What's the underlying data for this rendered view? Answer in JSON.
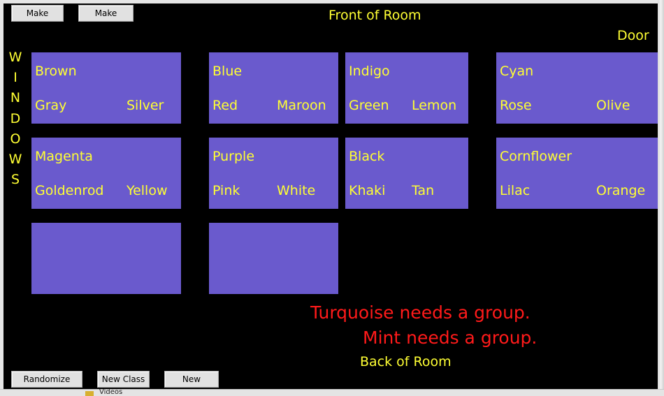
{
  "toolbar": {
    "make_bigger": "Make bigger",
    "make_smaller": "Make smaller"
  },
  "room": {
    "front": "Front of Room",
    "door": "Door",
    "windows_letters": [
      "W",
      "I",
      "N",
      "D",
      "O",
      "W",
      "S"
    ],
    "back": "Back of Room"
  },
  "groups": [
    {
      "top": "Brown",
      "left": "Gray",
      "right": "Silver"
    },
    {
      "top": "Blue",
      "left": "Red",
      "right": "Maroon"
    },
    {
      "top": "Indigo",
      "left": "Green",
      "right": "Lemon"
    },
    {
      "top": "Cyan",
      "left": "Rose",
      "right": "Olive"
    },
    {
      "top": "Magenta",
      "left": "Goldenrod",
      "right": "Yellow"
    },
    {
      "top": "Purple",
      "left": "Pink",
      "right": "White"
    },
    {
      "top": "Black",
      "left": "Khaki",
      "right": "Tan"
    },
    {
      "top": "Cornflower",
      "left": "Lilac",
      "right": "Orange"
    },
    {
      "top": "",
      "left": "",
      "right": ""
    },
    {
      "top": "",
      "left": "",
      "right": ""
    }
  ],
  "messages": [
    "Turquoise needs a group.",
    "Mint needs a group."
  ],
  "bottom_buttons": {
    "randomize": "Randomize Again",
    "new_class": "New Class",
    "new_options": "New Options"
  },
  "taskbar_peek": {
    "label": "Videos"
  },
  "colors": {
    "background": "#000000",
    "group_fill": "#6a5acd",
    "name_text": "#ffff33",
    "warning_text": "#ff1a1a"
  }
}
